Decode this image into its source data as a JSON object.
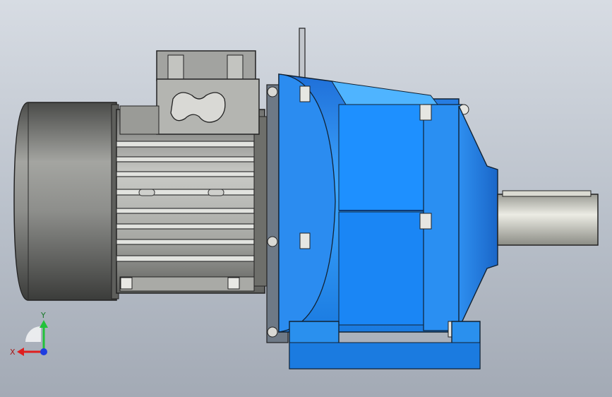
{
  "viewport": {
    "background_top": "#d7dce3",
    "background_bottom": "#a3aab5"
  },
  "model": {
    "motor_color": "#8f918f",
    "gearbox_color": "#2a95ee",
    "shaft_color": "#cfcfc6"
  },
  "triad": {
    "x_label": "X",
    "y_label": "Y",
    "x_color": "#e01f1f",
    "y_color": "#22c23a",
    "z_color": "#1f3de0"
  }
}
